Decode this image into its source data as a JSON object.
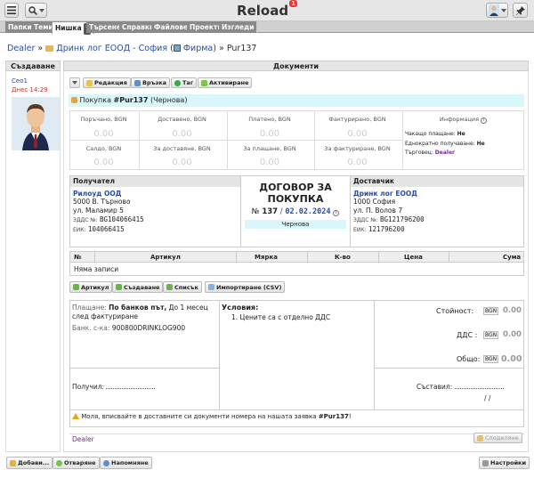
{
  "app": {
    "title": "Reload",
    "notif_count": "1"
  },
  "tabs": [
    {
      "label": "Папки"
    },
    {
      "label": "Теми"
    },
    {
      "label": "Нишка"
    },
    {
      "label": "Търсене"
    },
    {
      "label": "Справки"
    },
    {
      "label": "Файлове"
    },
    {
      "label": "Проекти"
    },
    {
      "label": "Изгледи"
    }
  ],
  "help_mark": "?",
  "breadcrumb": {
    "root": "Dealer",
    "sep1": "»",
    "folder": "Дринк лог ЕООД - София",
    "paren_open": "(",
    "type": "Фирма",
    "paren_close": ")",
    "sep2": "»",
    "current": "Pur137"
  },
  "left": {
    "header": "Създаване",
    "author": "Ceo1",
    "date": "Днес 14:29"
  },
  "main": {
    "header": "Документи",
    "toolbar": {
      "edit": "Редакция",
      "link": "Връзка",
      "tag": "Таг",
      "activate": "Активиране"
    },
    "doc_prefix": "Покупка ",
    "doc_id": "#Pur137",
    "doc_state": "(Чернова)",
    "summary_row1": [
      {
        "label": "Поръчано, BGN",
        "value": "0.00"
      },
      {
        "label": "Доставено, BGN",
        "value": "0.00"
      },
      {
        "label": "Платено, BGN",
        "value": "0.00"
      },
      {
        "label": "Фактурирано, BGN",
        "value": "0.00"
      }
    ],
    "summary_row2": [
      {
        "label": "Салдо, BGN",
        "value": "0.00"
      },
      {
        "label": "За доставяне, BGN",
        "value": "0.00"
      },
      {
        "label": "За плащане, BGN",
        "value": "0.00"
      },
      {
        "label": "За фактуриране, BGN",
        "value": "0.00"
      }
    ],
    "info": {
      "label": "Информация",
      "waiting_label": "Чакащо плащане:",
      "waiting_value": "Не",
      "once_label": "Еднократно получаване:",
      "once_value": "Не",
      "trader_label": "Търговец:",
      "trader_value": "Dealer"
    },
    "recipient": {
      "header": "Получател",
      "name": "Рилоуд ООД",
      "address1": "5000 В. Търново",
      "address2": "ул. Маламир 5",
      "vat_label": "ЗДДС №:",
      "vat": "BG104066415",
      "eik_label": "ЕИК:",
      "eik": "104066415"
    },
    "contract": {
      "title_line1": "ДОГОВОР ЗА",
      "title_line2": "ПОКУПКА",
      "no_label": "№",
      "number": "137",
      "slash": "/",
      "date": "02.02.2024",
      "status": "Чернова"
    },
    "supplier": {
      "header": "Доставчик",
      "name": "Дринк лог ЕООД",
      "address1": "1000 София",
      "address2": "ул. П. Волов 7",
      "vat_label": "ЗДДС №:",
      "vat": "BG121796200",
      "eik_label": "ЕИК:",
      "eik": "121796200"
    },
    "items": {
      "columns": [
        "№",
        "Артикул",
        "Мярка",
        "К-во",
        "Цена",
        "Сума"
      ],
      "empty": "Няма записи"
    },
    "item_buttons": {
      "article": "Артикул",
      "create": "Създаване",
      "list": "Списък",
      "import": "Импортиране (CSV)"
    },
    "payment": {
      "method_label": "Плащане:",
      "method_value": "По банков път,",
      "method_rest1": "До 1 месец",
      "method_rest2": "след фактуриране",
      "bank_label": "Банк. с-ка:",
      "bank_value": "900800DRINKLOG900"
    },
    "conditions": {
      "label": "Условия:",
      "items": [
        "1. Цените са с отделно ДДС"
      ]
    },
    "totals": {
      "cost_label": "Стойност:",
      "vat_label": "ДДС :",
      "total_label": "Общо:",
      "currency": "BGN",
      "cost": "0.00",
      "vat": "0.00",
      "total": "0.00"
    },
    "received_label": "Получил:",
    "composed_label": "Съставил:",
    "composed_slashes": "/ /",
    "notice_prefix": "Моля, вписвайте в доставните си документи номера на нашата заявка ",
    "notice_id": "#Pur137",
    "notice_suffix": "!",
    "footer_author": "Dealer",
    "share_label": "Споделяне"
  },
  "footer": {
    "add": "Добави...",
    "open": "Отваряне",
    "remind": "Напомняне",
    "settings": "Настройки"
  },
  "colors": {
    "link": "#2a4ea0",
    "cyan_bg": "#d9f6fb",
    "badge": "#e53935",
    "date_red": "#c0392b"
  }
}
